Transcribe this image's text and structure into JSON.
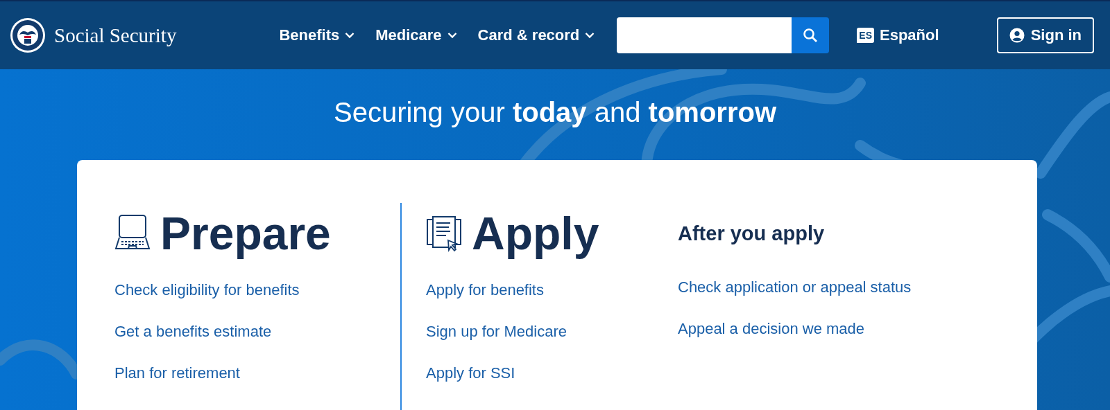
{
  "header": {
    "logo_text": "Social Security",
    "nav": [
      {
        "label": "Benefits"
      },
      {
        "label": "Medicare"
      },
      {
        "label": "Card & record"
      }
    ],
    "language": {
      "badge": "ES",
      "label": "Español"
    },
    "sign_in": "Sign in"
  },
  "hero": {
    "title": "Securing your **today** and **tomorrow**"
  },
  "columns": [
    {
      "kind": "laptop",
      "title": "Prepare",
      "divider_after": true,
      "links": [
        "Check eligibility for benefits",
        "Get a benefits estimate",
        "Plan for retirement"
      ]
    },
    {
      "kind": "documents",
      "title": "Apply",
      "divider_after": false,
      "links": [
        "Apply for benefits",
        "Sign up for Medicare",
        "Apply for SSI"
      ]
    },
    {
      "kind": "text",
      "title": "After you apply",
      "divider_after": false,
      "links": [
        "Check application or appeal status",
        "Appeal a decision we made"
      ]
    }
  ]
}
